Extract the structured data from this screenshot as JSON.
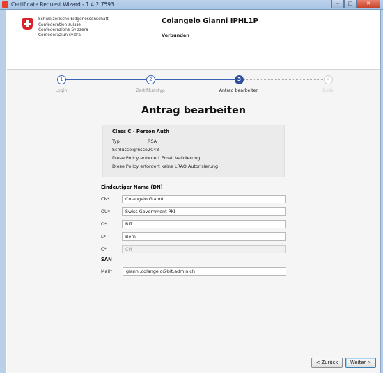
{
  "window": {
    "title": "Certificate Request Wizard - 1.4.2.7593"
  },
  "header": {
    "confederation": [
      "Schweizerische Eidgenossenschaft",
      "Confédération suisse",
      "Confederazione Svizzera",
      "Confederaziun svizra"
    ],
    "user_name": "Colangelo Gianni IPHL1P",
    "status": "Verbunden"
  },
  "steps": [
    {
      "number": "1",
      "label": "Login",
      "state": "done"
    },
    {
      "number": "2",
      "label": "Zertifikatstyp",
      "state": "done"
    },
    {
      "number": "3",
      "label": "Antrag bearbeiten",
      "state": "active"
    },
    {
      "number": "4",
      "label": "Ende",
      "state": "todo"
    }
  ],
  "page": {
    "title": "Antrag bearbeiten"
  },
  "info": {
    "title": "Class C - Person Auth",
    "typ_label": "Typ",
    "typ_value": "RSA",
    "key_label": "Schlüsselgrösse",
    "key_value": "2048",
    "policy1": "Diese Policy erfordert Email Validierung",
    "policy2": "Diese Policy erfordert keine LRAO Autorisierung"
  },
  "dn": {
    "heading": "Eindeutiger Name (DN)",
    "fields": [
      {
        "label": "CN*",
        "value": "Colangelo Gianni",
        "disabled": false
      },
      {
        "label": "OU*",
        "value": "Swiss Government PKI",
        "disabled": false
      },
      {
        "label": "O*",
        "value": "BIT",
        "disabled": false
      },
      {
        "label": "L*",
        "value": "Bern",
        "disabled": false
      },
      {
        "label": "C*",
        "value": "CH",
        "disabled": true
      }
    ]
  },
  "san": {
    "heading": "SAN",
    "mail_label": "Mail*",
    "mail_value": "gianni.colangelo@bit.admin.ch"
  },
  "buttons": {
    "back_prefix": "< ",
    "back_mnemonic": "Z",
    "back_rest": "urück",
    "next_mnemonic": "W",
    "next_rest": "eiter >"
  },
  "colors": {
    "accent": "#2e4f9e",
    "flag": "#d8232a",
    "titlebar": "#bcd3ec"
  }
}
